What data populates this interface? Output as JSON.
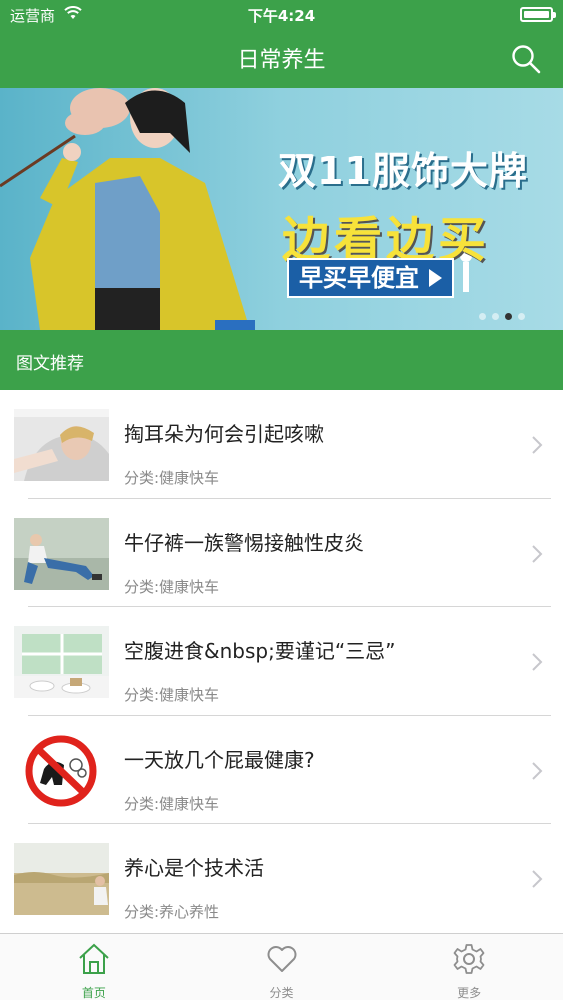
{
  "status_bar": {
    "carrier": "运营商",
    "time": "下午4:24"
  },
  "nav": {
    "title": "日常养生"
  },
  "banner": {
    "headline": "双11服饰大牌",
    "subhead": "边看边买",
    "cta": "早买早便宜",
    "page_count": 4,
    "active_page": 2
  },
  "section": {
    "title": "图文推荐"
  },
  "articles": [
    {
      "title": "掏耳朵为何会引起咳嗽",
      "category": "分类:健康快车"
    },
    {
      "title": "牛仔裤一族警惕接触性皮炎",
      "category": "分类:健康快车"
    },
    {
      "title": "空腹进食&nbsp;要谨记“三忌”",
      "category": "分类:健康快车"
    },
    {
      "title": "一天放几个屁最健康?",
      "category": "分类:健康快车"
    },
    {
      "title": "养心是个技术活",
      "category": "分类:养心养性"
    }
  ],
  "tabbar": {
    "home": "首页",
    "category": "分类",
    "more": "更多"
  },
  "colors": {
    "brand_green": "#3ca14a",
    "banner_cta_blue": "#1b5fa6",
    "banner_yellow": "#f7e23a"
  }
}
